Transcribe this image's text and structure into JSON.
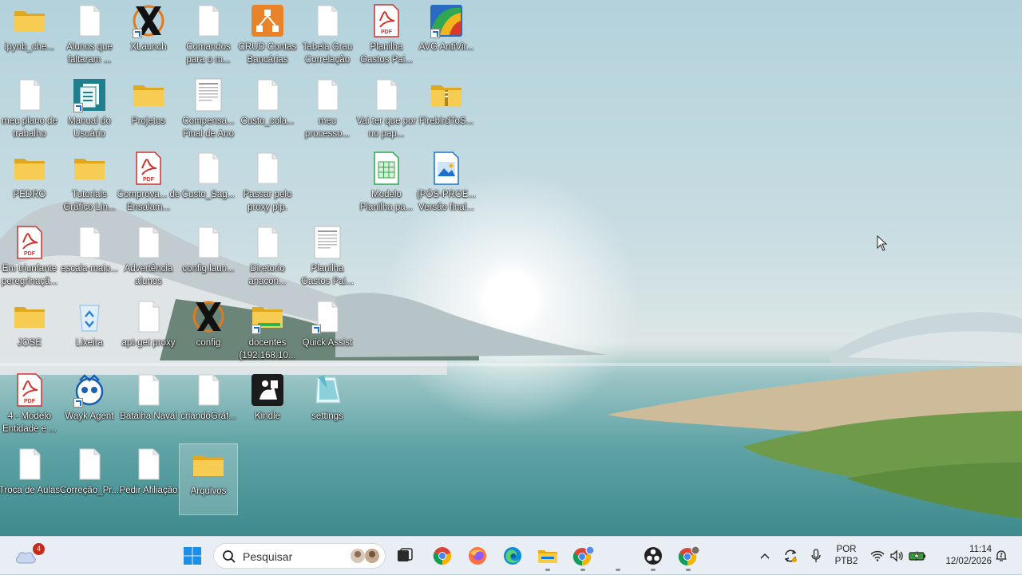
{
  "desktop": {
    "icons": [
      {
        "label": "ipynb_che...",
        "type": "folder"
      },
      {
        "label": "Alunos que faltaram ...",
        "type": "file"
      },
      {
        "label": "XLaunch",
        "type": "xlaunch"
      },
      {
        "label": "Comandos para o m...",
        "type": "file"
      },
      {
        "label": "CRUD Contas Bancárias",
        "type": "crud"
      },
      {
        "label": "Tabela Grau Correlação",
        "type": "file"
      },
      {
        "label": "Planilha Gastos Pai...",
        "type": "pdf"
      },
      {
        "label": "AVG AntiVir...",
        "type": "avg"
      },
      {
        "label": "meu plano de trabalho",
        "type": "file"
      },
      {
        "label": "Manual do Usuário",
        "type": "manual"
      },
      {
        "label": "Projetos",
        "type": "folder"
      },
      {
        "label": "Compensa... Final de Ano",
        "type": "doc"
      },
      {
        "label": "Custo_cola...",
        "type": "file"
      },
      {
        "label": "meu processo...",
        "type": "file"
      },
      {
        "label": "Vai ter que por no pap...",
        "type": "file"
      },
      {
        "label": "FirebirdToS...",
        "type": "zipfolder"
      },
      {
        "label": "PEDRO",
        "type": "folder"
      },
      {
        "label": "Tutoriais Gráfico Lin...",
        "type": "folder"
      },
      {
        "label": "Comprova... de Ensalam...",
        "type": "pdf"
      },
      {
        "label": "Custo_Sag...",
        "type": "file"
      },
      {
        "label": "Passar pelo proxy pip.",
        "type": "file"
      },
      {
        "label": "Modelo Planilha pa...",
        "type": "sheet"
      },
      {
        "label": "(PÓS-PROE... Versão final...",
        "type": "image"
      },
      {
        "label": "Em triunfante peregrinaçã...",
        "type": "pdf"
      },
      {
        "label": "escala-maio...",
        "type": "file"
      },
      {
        "label": "Advertência alunos",
        "type": "file"
      },
      {
        "label": "config.laun...",
        "type": "file"
      },
      {
        "label": "Diretorio anacon...",
        "type": "file"
      },
      {
        "label": "Planilha Gastos Pai...",
        "type": "doc"
      },
      {
        "label": "JOSE",
        "type": "folder"
      },
      {
        "label": "Lixeira",
        "type": "recycle"
      },
      {
        "label": "apt-get proxy",
        "type": "file"
      },
      {
        "label": "config",
        "type": "xlaunch"
      },
      {
        "label": "docentes (192.168.10...",
        "type": "netfolder"
      },
      {
        "label": "Quick Assist",
        "type": "file"
      },
      {
        "label": "4 - Modelo Entidade e ...",
        "type": "pdf"
      },
      {
        "label": "Wayk Agent",
        "type": "wayk"
      },
      {
        "label": "Batalha Naval",
        "type": "file"
      },
      {
        "label": "criandoGraf...",
        "type": "file"
      },
      {
        "label": "Kindle",
        "type": "kindle"
      },
      {
        "label": "settings",
        "type": "settings"
      },
      {
        "label": "Troca de Aulas",
        "type": "file"
      },
      {
        "label": "Correção_Pr...",
        "type": "file"
      },
      {
        "label": "Pedir Afiliação",
        "type": "file"
      },
      {
        "label": "Arquivos",
        "type": "folder"
      }
    ]
  },
  "taskbar": {
    "weather_badge": "4",
    "search_placeholder": "Pesquisar",
    "apps": [
      "start-icon",
      "search-icon",
      "task-view-icon",
      "chrome-icon",
      "firefox-icon",
      "edge-icon",
      "file-explorer-icon",
      "chrome-profile-icon",
      "obs-icon",
      "chrome-profile-2-icon"
    ],
    "lang_line1": "POR",
    "lang_line2": "PTB2",
    "time": "11:14",
    "date": "12/02/2026"
  },
  "colors": {
    "taskbar_bg": "#e8eef3",
    "folder": "#f2c94c",
    "pdf_red": "#d0312d",
    "accent_blue": "#0067c0"
  }
}
